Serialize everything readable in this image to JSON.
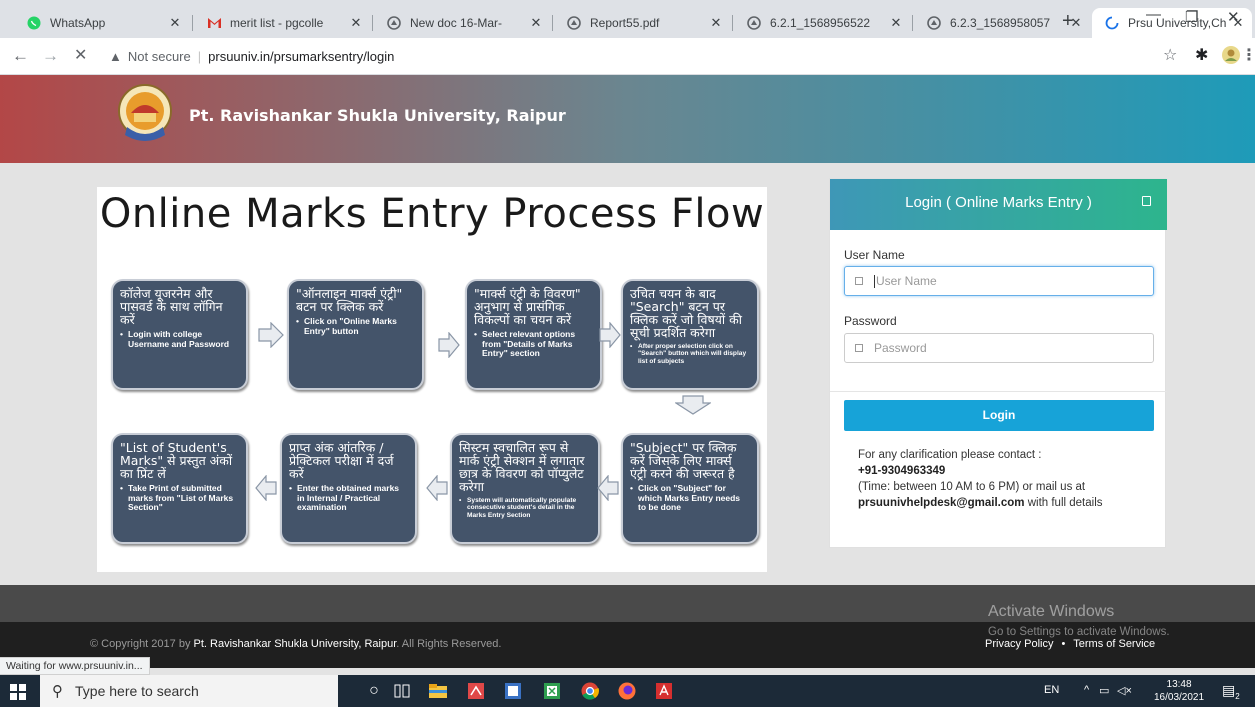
{
  "browser": {
    "tabs": [
      {
        "title": "WhatsApp",
        "icon": "whatsapp-icon"
      },
      {
        "title": "merit list - pgcolle",
        "icon": "gmail-icon"
      },
      {
        "title": "New doc 16-Mar-",
        "icon": "globe-icon"
      },
      {
        "title": "Report55.pdf",
        "icon": "globe-icon"
      },
      {
        "title": "6.2.1_1568956522",
        "icon": "globe-icon"
      },
      {
        "title": "6.2.3_1568958057",
        "icon": "globe-icon"
      },
      {
        "title": "Prsu University,Ch",
        "icon": "loading-icon"
      }
    ],
    "address": {
      "security": "Not secure",
      "url": "prsuuniv.in/prsumarksentry/login"
    }
  },
  "header": {
    "title": "Pt. Ravishankar Shukla University, Raipur"
  },
  "flow": {
    "title": "Online Marks Entry Process Flow",
    "steps": [
      {
        "hindi": "कॉलेज यूजरनेम और पासवर्ड के साथ लॉगिन करें",
        "english": "Login with college Username and Password"
      },
      {
        "hindi": "\"ऑनलाइन मार्क्स एंट्री\" बटन पर क्लिक करें",
        "english": "Click on \"Online Marks Entry\" button"
      },
      {
        "hindi": "\"मार्क्स एंट्री के विवरण\" अनुभाग से प्रासंगिक विकल्पों का चयन करें",
        "english": "Select relevant options from \"Details of Marks Entry\" section"
      },
      {
        "hindi": "उचित चयन के बाद \"Search\" बटन पर क्लिक करें जो विषयों की सूची प्रदर्शित करेगा",
        "english": "After proper selection click on \"Search\" button which will display list of subjects"
      },
      {
        "hindi": "\"Subject\" पर क्लिक करें जिसके लिए मार्क्स एंट्री करने की जरूरत है",
        "english": "Click on \"Subject\" for which Marks Entry needs to be done"
      },
      {
        "hindi": "सिस्टम स्वचालित रूप से मार्क एंट्री सेक्शन में लगातार छात्र के विवरण को पॉप्युलेट करेगा",
        "english": "System will automatically populate consecutive student's detail in the Marks Entry Section"
      },
      {
        "hindi": "प्राप्त अंक आंतरिक / प्रेक्टिकल परीक्षा में दर्ज करें",
        "english": "Enter the obtained marks in Internal / Practical examination"
      },
      {
        "hindi": "\"List of Student's Marks\" से प्रस्तुत अंकों का प्रिंट लें",
        "english": "Take Print of submitted marks from \"List of Marks Section\""
      }
    ]
  },
  "login": {
    "title": "Login ( Online Marks Entry )",
    "username_label": "User Name",
    "username_placeholder": "User Name",
    "password_label": "Password",
    "password_placeholder": "Password",
    "button": "Login",
    "contact_intro": "For any clarification please contact :",
    "phone": "+91-9304963349",
    "time_note": "(Time: between 10 AM to 6 PM) or mail us at",
    "email": "prsuunivhelpdesk@gmail.com",
    "email_suffix": " with full details"
  },
  "footer": {
    "copyright_prefix": "© Copyright 2017 by ",
    "copyright_org": "Pt. Ravishankar Shukla University, Raipur",
    "copyright_suffix": ". All Rights Reserved.",
    "privacy": "Privacy Policy",
    "bullet": "•",
    "terms": "Terms of Service"
  },
  "watermark": {
    "line1": "Activate Windows",
    "line2": "Go to Settings to activate Windows."
  },
  "status": "Waiting for www.prsuuniv.in...",
  "taskbar": {
    "search_placeholder": "Type here to search",
    "lang": "EN",
    "time": "13:48",
    "date": "16/03/2021",
    "notifications": "2"
  },
  "colors": {
    "header_left": "#b34747",
    "header_right": "#1e9bb9",
    "login_btn": "#17a3d8",
    "step_box": "#44546a"
  }
}
